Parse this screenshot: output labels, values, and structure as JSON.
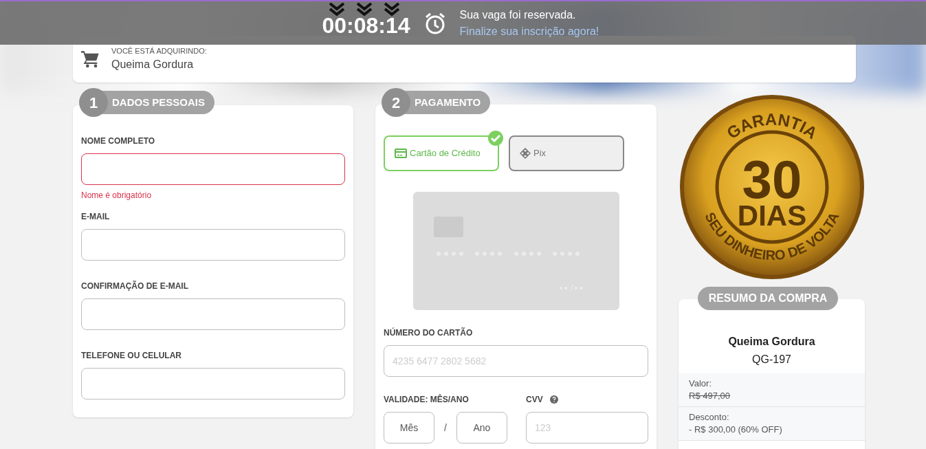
{
  "countdown": {
    "time": "00:08:14",
    "message": "Sua vaga foi reservada.",
    "link": "Finalize sua inscrição agora!"
  },
  "product_bar": {
    "caption": "VOCÊ ESTÁ ADQUIRINDO:",
    "product": "Queima Gordura"
  },
  "personal": {
    "step": "1",
    "title": "DADOS PESSOAIS",
    "fields": [
      {
        "label": "NOME COMPLETO",
        "invalid": true,
        "error": "Nome é obrigatório"
      },
      {
        "label": "E-MAIL",
        "invalid": false
      },
      {
        "label": "CONFIRMAÇÃO DE E-MAIL",
        "invalid": false
      },
      {
        "label": "TELEFONE OU CELULAR",
        "invalid": false
      }
    ]
  },
  "payment": {
    "step": "2",
    "title": "PAGAMENTO",
    "methods": [
      {
        "kind": "card",
        "label": "Cartão de Crédito",
        "selected": true
      },
      {
        "kind": "pix",
        "label": "Pix",
        "selected": false
      }
    ],
    "card_number": {
      "label": "NÚMERO DO CARTÃO",
      "placeholder": "4235 6477 2802 5682"
    },
    "expiry": {
      "label": "VALIDADE: MÊS/ANO",
      "month": {
        "placeholder": "Mês"
      },
      "separator": "/",
      "year": {
        "placeholder": "Ano"
      }
    },
    "cvv": {
      "label": "CVV",
      "placeholder": "123"
    }
  },
  "seal": {
    "top": "GARANTIA",
    "number": "30",
    "word": "DIAS",
    "bottom": "SEU DINHEIRO DE VOLTA"
  },
  "summary": {
    "title": "RESUMO DA COMPRA",
    "product": "Queima Gordura",
    "code": "QG-197",
    "rows": [
      {
        "label": "Valor:",
        "value": "R$ 497,00",
        "struck": true
      },
      {
        "label": "Desconto:",
        "value": "- R$ 300,00 (60% OFF)",
        "struck": false
      }
    ]
  }
}
